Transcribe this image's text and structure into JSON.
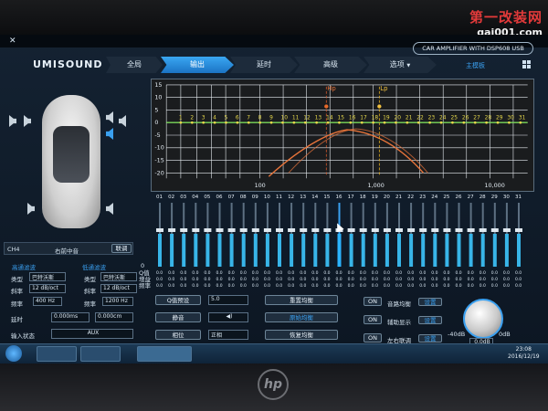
{
  "watermark": {
    "line1": "第一改装网",
    "line2": "gai001.com"
  },
  "device_label": "CAR AMPLIFIER WITH DSP608 USB",
  "app_logo": "UMISOUND",
  "tabs": [
    {
      "label": "全局"
    },
    {
      "label": "输出"
    },
    {
      "label": "延时"
    },
    {
      "label": "高级"
    },
    {
      "label": "选项"
    }
  ],
  "header_link": "主模板",
  "graph": {
    "yticks": [
      15,
      10,
      5,
      0,
      -5,
      -10,
      -15,
      -20
    ],
    "xticks": [
      "100",
      "1,000",
      "10,000"
    ],
    "hp_label": "Hp",
    "lp_label": "Lp",
    "point_numbers": [
      "1",
      "2",
      "3",
      "4",
      "5",
      "6",
      "7",
      "8",
      "9",
      "10",
      "11",
      "12",
      "13",
      "14",
      "15",
      "16",
      "17",
      "18",
      "19",
      "20",
      "21",
      "22",
      "23",
      "24",
      "25",
      "26",
      "27",
      "28",
      "29",
      "30",
      "31"
    ]
  },
  "faders": {
    "numbers": [
      "01",
      "02",
      "03",
      "04",
      "05",
      "06",
      "07",
      "08",
      "09",
      "10",
      "11",
      "12",
      "13",
      "14",
      "15",
      "16",
      "17",
      "18",
      "19",
      "20",
      "21",
      "22",
      "23",
      "24",
      "25",
      "26",
      "27",
      "28",
      "29",
      "30",
      "31"
    ],
    "selected_index": 15,
    "level_scale": "0",
    "row_labels": [
      "Q值",
      "增益",
      "频率"
    ],
    "value_text": "0.0"
  },
  "channel": {
    "label": "CH4",
    "name": "右前中音",
    "link_button": "联调"
  },
  "filter": {
    "hp_title": "高通滤波",
    "lp_title": "低通滤波",
    "type_label": "类型",
    "type_value": "巴特沃斯",
    "slope_label": "斜率",
    "slope_value": "12 dB/oct",
    "freq_label": "频率",
    "hp_freq": "400 Hz",
    "lp_freq": "1200 Hz"
  },
  "delay": {
    "label": "延时",
    "ms": "0.000ms",
    "cm": "0.000cm"
  },
  "input": {
    "label": "输入状态",
    "value": "AUX"
  },
  "eq_controls": {
    "q_preset_label": "Q值预设",
    "q_preset_value": "5.0",
    "mute_label": "静音",
    "phase_label": "相位",
    "phase_value": "正相",
    "reset_button": "重置均衡",
    "bypass_button": "原始均衡",
    "restore_button": "恢复均衡"
  },
  "right_controls": {
    "on_label": "ON",
    "rows": [
      {
        "label": "音路均衡",
        "tag": "设置"
      },
      {
        "label": "辅助显示",
        "tag": "设置"
      },
      {
        "label": "左右联调",
        "tag": "设置"
      }
    ]
  },
  "master": {
    "min": "-40dB",
    "max": "0dB",
    "value": "0.0dB"
  },
  "taskbar": {
    "time": "23:08",
    "date": "2016/12/19"
  },
  "colors": {
    "accent": "#3aa0f0",
    "curve": "#e8743a",
    "hp_line": "#d45a2e",
    "lp_line": "#e3b020",
    "flat_line": "#7bd85a"
  }
}
